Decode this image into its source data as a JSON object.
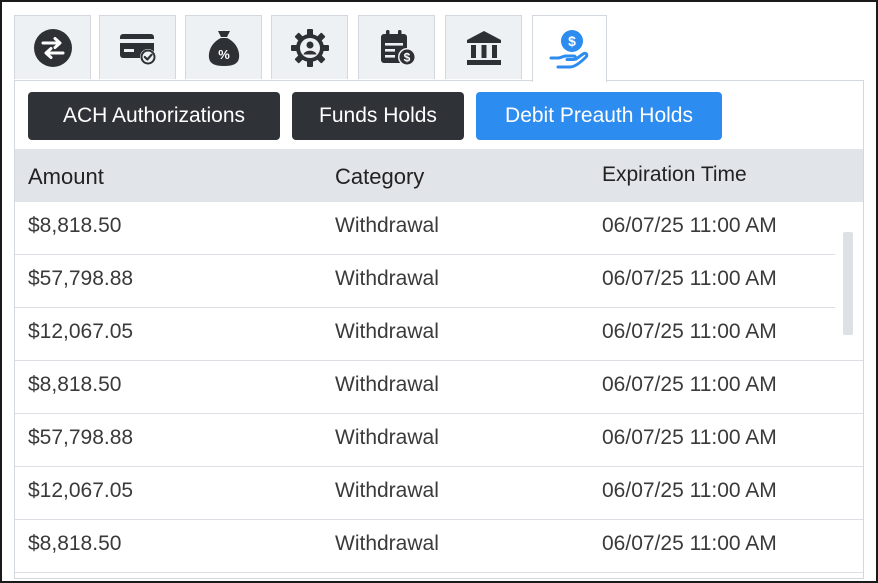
{
  "tabs": [
    {
      "icon": "transfer-icon",
      "active": false
    },
    {
      "icon": "card-check-icon",
      "active": false
    },
    {
      "icon": "money-bag-percent-icon",
      "active": false
    },
    {
      "icon": "gear-user-icon",
      "active": false
    },
    {
      "icon": "statement-dollar-icon",
      "active": false
    },
    {
      "icon": "bank-icon",
      "active": false
    },
    {
      "icon": "hand-dollar-icon",
      "active": true
    }
  ],
  "subtabs": {
    "ach": "ACH Authorizations",
    "funds": "Funds Holds",
    "debit": "Debit Preauth Holds",
    "active": "debit"
  },
  "table": {
    "headers": {
      "amount": "Amount",
      "category": "Category",
      "expiration": "Expiration Time"
    },
    "rows": [
      {
        "amount": "$8,818.50",
        "category": "Withdrawal",
        "expiration": "06/07/25 11:00 AM"
      },
      {
        "amount": "$57,798.88",
        "category": "Withdrawal",
        "expiration": "06/07/25 11:00 AM"
      },
      {
        "amount": "$12,067.05",
        "category": "Withdrawal",
        "expiration": "06/07/25 11:00 AM"
      },
      {
        "amount": "$8,818.50",
        "category": "Withdrawal",
        "expiration": "06/07/25 11:00 AM"
      },
      {
        "amount": "$57,798.88",
        "category": "Withdrawal",
        "expiration": "06/07/25 11:00 AM"
      },
      {
        "amount": "$12,067.05",
        "category": "Withdrawal",
        "expiration": "06/07/25 11:00 AM"
      },
      {
        "amount": "$8,818.50",
        "category": "Withdrawal",
        "expiration": "06/07/25 11:00 AM"
      }
    ]
  },
  "colors": {
    "active_accent": "#2c8cf0",
    "dark_button": "#2f3237",
    "icon_dark": "#2d3035",
    "header_bg": "#e1e4e8"
  }
}
